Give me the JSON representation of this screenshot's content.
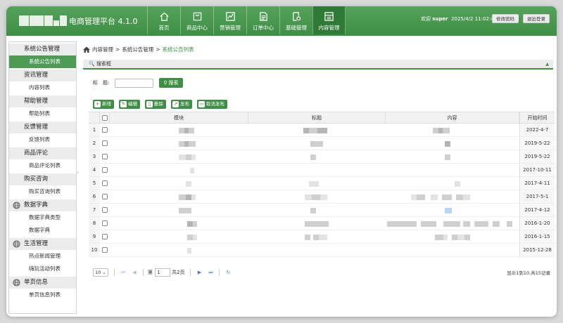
{
  "app": {
    "title": "· 电商管理平台 4.1.0"
  },
  "nav": [
    {
      "label": "首页",
      "icon": "home-icon",
      "active": false
    },
    {
      "label": "商品中心",
      "icon": "bag-icon",
      "active": false
    },
    {
      "label": "营销管理",
      "icon": "chart-icon",
      "active": false
    },
    {
      "label": "订单中心",
      "icon": "order-icon",
      "active": false
    },
    {
      "label": "基础管理",
      "icon": "settings-doc-icon",
      "active": false
    },
    {
      "label": "内容管理",
      "icon": "content-icon",
      "active": true
    }
  ],
  "header": {
    "welcome_prefix": "欢迎 ",
    "user": "super",
    "datetime": "2025/4/2 11:02:49",
    "change_password": "修改密码",
    "separator": "|",
    "logout": "退出登录"
  },
  "sidebar": [
    {
      "group": "系统公告管理",
      "icon": "",
      "items": [
        {
          "label": "系统公告列表",
          "active": true
        }
      ]
    },
    {
      "group": "资讯管理",
      "icon": "",
      "items": [
        {
          "label": "内容列表",
          "active": false
        }
      ]
    },
    {
      "group": "帮助管理",
      "icon": "",
      "items": [
        {
          "label": "帮助列表",
          "active": false
        }
      ]
    },
    {
      "group": "反馈管理",
      "icon": "",
      "items": [
        {
          "label": "反馈列表",
          "active": false
        }
      ]
    },
    {
      "group": "商品评论",
      "icon": "",
      "items": [
        {
          "label": "商品评论列表",
          "active": false
        }
      ]
    },
    {
      "group": "购买咨询",
      "icon": "",
      "items": [
        {
          "label": "购买咨询列表",
          "active": false
        }
      ]
    },
    {
      "group": "数据字典",
      "icon": "globe-icon",
      "items": [
        {
          "label": "数据字典类型",
          "active": false
        },
        {
          "label": "数据字典",
          "active": false
        }
      ]
    },
    {
      "group": "生活管理",
      "icon": "globe-icon",
      "items": [
        {
          "label": "热点新闻管理",
          "active": false
        },
        {
          "label": "嗨玩活动列表",
          "active": false
        }
      ]
    },
    {
      "group": "单页信息",
      "icon": "globe-icon",
      "items": [
        {
          "label": "单页信息列表",
          "active": false
        }
      ]
    }
  ],
  "breadcrumb": {
    "items": [
      "内容管理",
      "系统公告管理"
    ],
    "current": "系统公告列表",
    "separator": ">"
  },
  "search": {
    "panel_title": "搜索框",
    "label": "标　题:",
    "value": "",
    "button": "搜索"
  },
  "toolbar": {
    "add": "新增",
    "edit": "编辑",
    "delete": "删除",
    "publish": "发布",
    "unpublish": "取消发布"
  },
  "table": {
    "columns": [
      "模块",
      "标题",
      "内容",
      "开始时间"
    ],
    "rows": [
      {
        "num": "1",
        "date": "2022-4-7"
      },
      {
        "num": "2",
        "date": "2019-5-22"
      },
      {
        "num": "3",
        "date": "2019-5-22"
      },
      {
        "num": "4",
        "date": "2017-10-11"
      },
      {
        "num": "5",
        "date": "2017-4-11"
      },
      {
        "num": "6",
        "date": "2017-5-1"
      },
      {
        "num": "7",
        "date": "2017-4-12"
      },
      {
        "num": "8",
        "date": "2016-1-20"
      },
      {
        "num": "9",
        "date": "2016-1-15"
      },
      {
        "num": "10",
        "date": "2015-12-28"
      }
    ]
  },
  "pager": {
    "page_size": "10",
    "page_prefix": "第",
    "page": "1",
    "page_suffix": "共2页",
    "info": "显示1到10,共15记录"
  },
  "colors": {
    "brand": "#3f8e46",
    "brand_dark": "#2f7a36",
    "link": "#4a7fc1"
  }
}
